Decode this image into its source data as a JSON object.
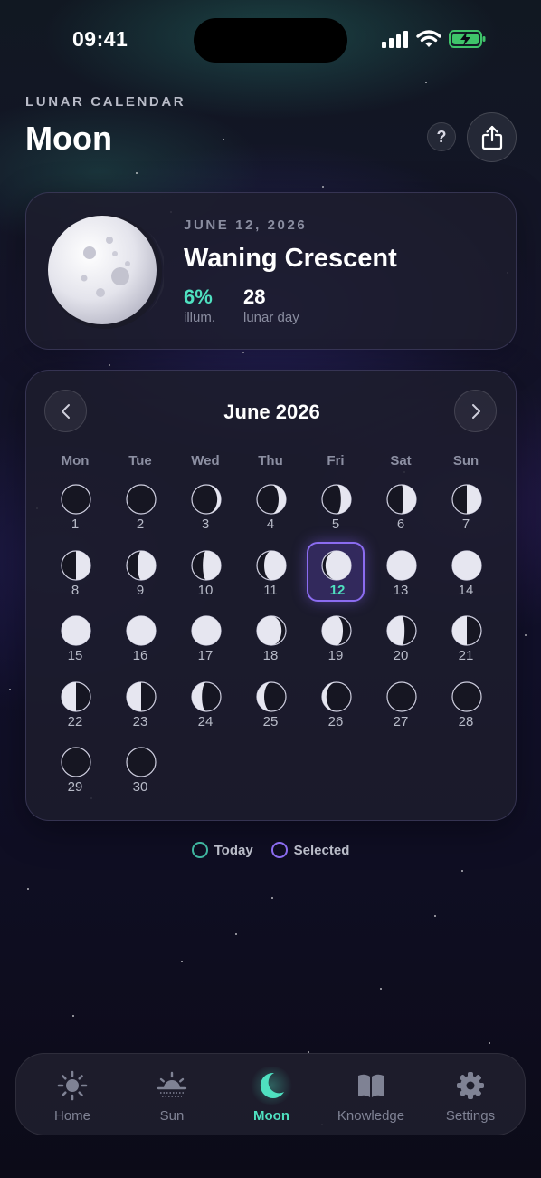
{
  "status_bar": {
    "time": "09:41"
  },
  "header": {
    "eyebrow": "LUNAR CALENDAR",
    "title": "Moon",
    "help_label": "?"
  },
  "moon_card": {
    "date": "JUNE 12, 2026",
    "phase": "Waning Crescent",
    "illumination": {
      "value": "6%",
      "label": "illum."
    },
    "lunar_day": {
      "value": "28",
      "label": "lunar day"
    }
  },
  "calendar": {
    "month_title": "June 2026",
    "weekdays": [
      "Mon",
      "Tue",
      "Wed",
      "Thu",
      "Fri",
      "Sat",
      "Sun"
    ],
    "days": [
      {
        "num": "1",
        "phase": "new"
      },
      {
        "num": "2",
        "phase": "new"
      },
      {
        "num": "3",
        "phase": "wax-crescent-1"
      },
      {
        "num": "4",
        "phase": "wax-crescent-2"
      },
      {
        "num": "5",
        "phase": "wax-crescent-3"
      },
      {
        "num": "6",
        "phase": "wax-crescent-4"
      },
      {
        "num": "7",
        "phase": "first-quarter"
      },
      {
        "num": "8",
        "phase": "first-quarter"
      },
      {
        "num": "9",
        "phase": "wax-gibbous-1"
      },
      {
        "num": "10",
        "phase": "wax-gibbous-1"
      },
      {
        "num": "11",
        "phase": "wax-gibbous-2"
      },
      {
        "num": "12",
        "phase": "wax-gibbous-3",
        "selected": true
      },
      {
        "num": "13",
        "phase": "full"
      },
      {
        "num": "14",
        "phase": "full"
      },
      {
        "num": "15",
        "phase": "full"
      },
      {
        "num": "16",
        "phase": "full"
      },
      {
        "num": "17",
        "phase": "full"
      },
      {
        "num": "18",
        "phase": "wan-gibbous-1"
      },
      {
        "num": "19",
        "phase": "wan-gibbous-2"
      },
      {
        "num": "20",
        "phase": "wan-gibbous-3"
      },
      {
        "num": "21",
        "phase": "last-quarter"
      },
      {
        "num": "22",
        "phase": "last-quarter"
      },
      {
        "num": "23",
        "phase": "last-quarter"
      },
      {
        "num": "24",
        "phase": "wan-crescent-1"
      },
      {
        "num": "25",
        "phase": "wan-crescent-2"
      },
      {
        "num": "26",
        "phase": "wan-crescent-3"
      },
      {
        "num": "27",
        "phase": "new"
      },
      {
        "num": "28",
        "phase": "new"
      },
      {
        "num": "29",
        "phase": "new"
      },
      {
        "num": "30",
        "phase": "new"
      }
    ]
  },
  "legend": {
    "today": "Today",
    "selected": "Selected"
  },
  "tabs": [
    {
      "label": "Home",
      "icon": "sun-icon"
    },
    {
      "label": "Sun",
      "icon": "sunrise-icon"
    },
    {
      "label": "Moon",
      "icon": "moon-icon",
      "active": true
    },
    {
      "label": "Knowledge",
      "icon": "book-icon"
    },
    {
      "label": "Settings",
      "icon": "gear-icon"
    }
  ],
  "colors": {
    "accent": "#4fe0c0",
    "selected": "#8b6cf0",
    "background": "#0b0b16"
  }
}
